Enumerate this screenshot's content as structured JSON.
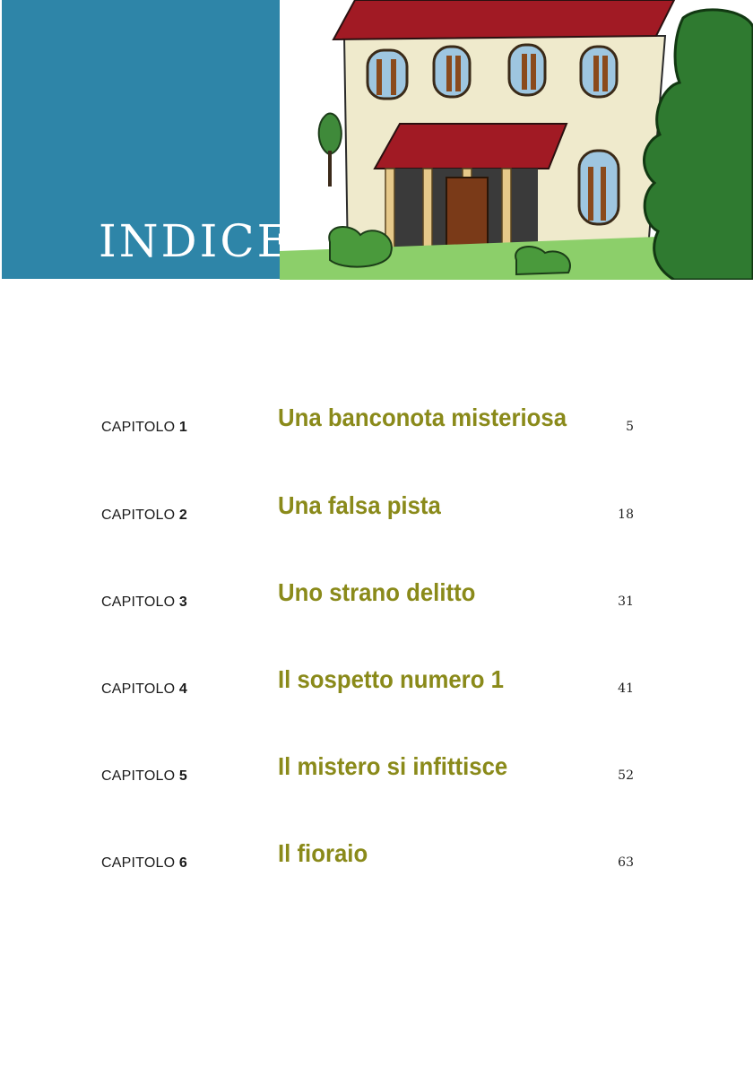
{
  "header": {
    "title": "INDICE"
  },
  "toc": {
    "chapter_prefix": "CAPITOLO",
    "entries": [
      {
        "number": "1",
        "title": "Una banconota misteriosa",
        "page": "5"
      },
      {
        "number": "2",
        "title": "Una falsa pista",
        "page": "18"
      },
      {
        "number": "3",
        "title": "Uno strano delitto",
        "page": "31"
      },
      {
        "number": "4",
        "title": "Il sospetto numero 1",
        "page": "41"
      },
      {
        "number": "5",
        "title": "Il mistero si infittisce",
        "page": "52"
      },
      {
        "number": "6",
        "title": "Il fioraio",
        "page": "63"
      }
    ]
  },
  "colors": {
    "banner_blue": "#2e85a8",
    "chapter_title": "#8a8a1a",
    "roof_red": "#a11a24"
  },
  "illustration": {
    "subject": "villa-house-icon"
  }
}
